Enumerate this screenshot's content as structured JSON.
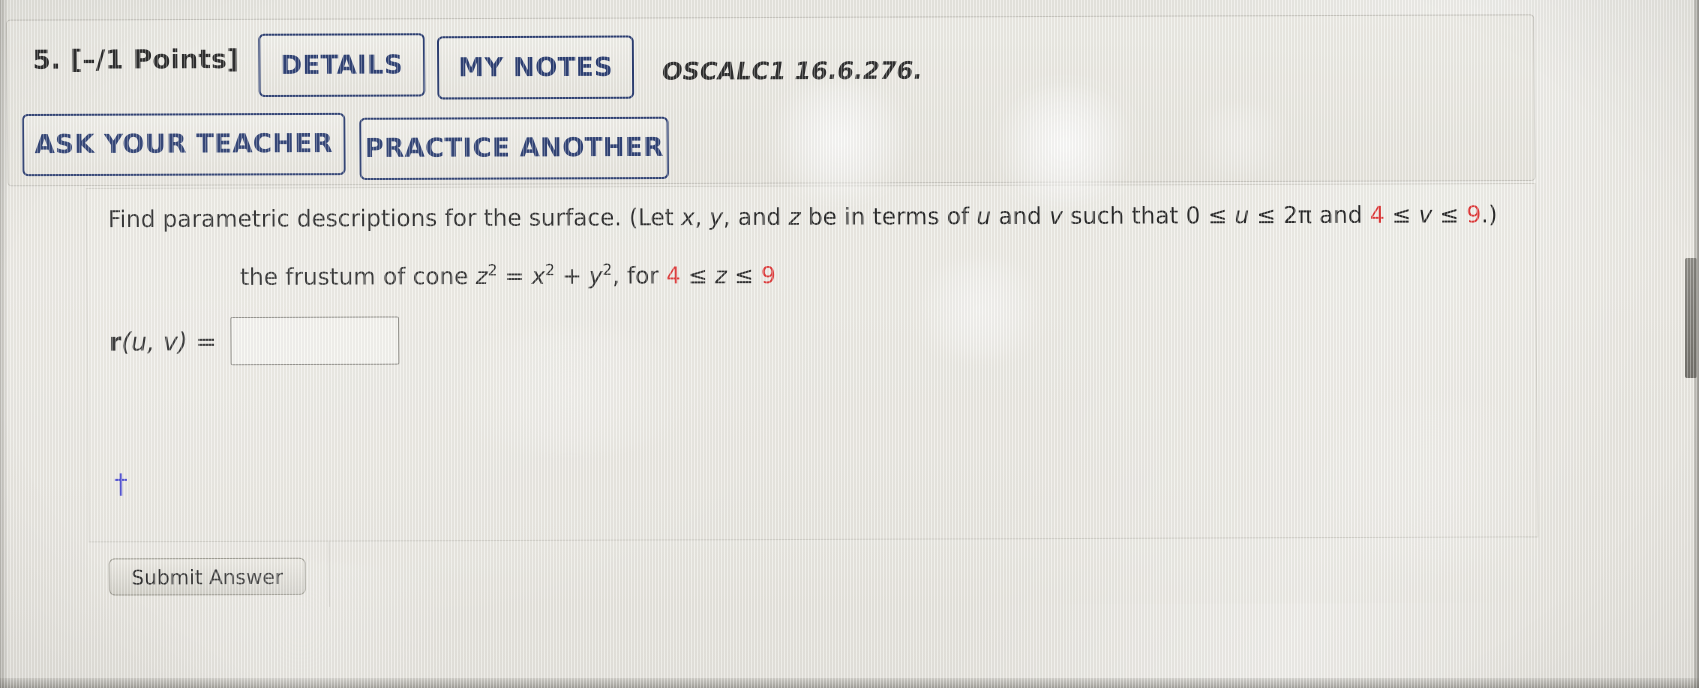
{
  "header": {
    "question_number": "5.",
    "points": "[–/1 Points]",
    "points_full": "5.  [–/1 Points]",
    "problem_id": "OSCALC1 16.6.276.",
    "buttons": [
      {
        "name": "details",
        "label": "DETAILS"
      },
      {
        "name": "my-notes",
        "label": "MY NOTES"
      },
      {
        "name": "ask-your-teacher",
        "label": "ASK YOUR TEACHER"
      },
      {
        "name": "practice-another",
        "label": "PRACTICE ANOTHER"
      }
    ]
  },
  "question": {
    "prompt_part1": "Find parametric descriptions for the surface. (Let ",
    "var_x": "x",
    "comma1": ", ",
    "var_y": "y",
    "and1": ", and ",
    "var_z": "z",
    "prompt_part2": " be in terms of ",
    "var_u": "u",
    "and2": " and ",
    "var_v": "v",
    "prompt_part3": " such that 0 ≤ ",
    "u_upper": " ≤ 2π and ",
    "range_v_lower": "4",
    "v_mid": " ≤ ",
    "range_v_upper": "9",
    "prompt_end": ".)",
    "surface_text_start": "the frustum of cone ",
    "surface_eq_z": "z",
    "surface_eq_eq": " = ",
    "surface_eq_x": "x",
    "surface_eq_plus": " + ",
    "surface_eq_y": "y",
    "surface_eq_for": ", for ",
    "range_z_lower": "4",
    "range_z_var": "z",
    "range_z_upper": "9",
    "exponent": "2",
    "footnote_symbol": "†"
  },
  "answer": {
    "label_bold": "r",
    "label_rest": "(u, v) = ",
    "label_plain": "r(u, v) =",
    "value": "",
    "placeholder": ""
  },
  "footer": {
    "submit_label": "Submit Answer"
  },
  "colors": {
    "accent_blue": "#2d3f73",
    "red_value": "#e03a3a",
    "dagger_blue": "#4a4ad0",
    "page_bg": "#e9e8e2"
  }
}
